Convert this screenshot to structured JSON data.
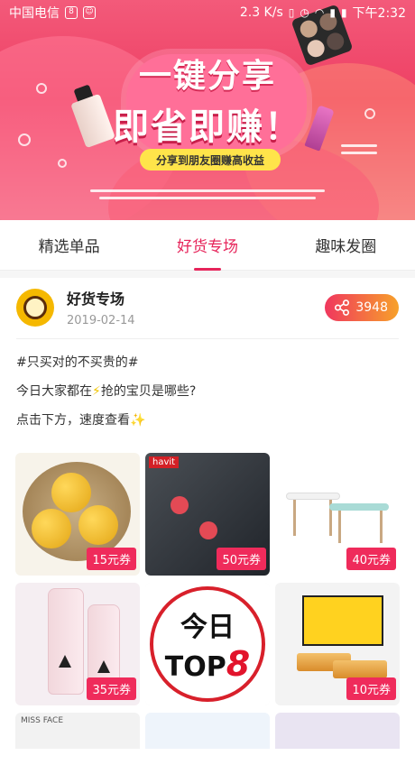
{
  "statusbar": {
    "carrier": "中国电信",
    "speed": "2.3 K/s",
    "time": "下午2:32"
  },
  "banner": {
    "line1": "一键分享",
    "line2": "即省即赚！",
    "subtitle": "分享到朋友圈赚高收益"
  },
  "tabs": [
    {
      "label": "精选单品"
    },
    {
      "label": "好货专场"
    },
    {
      "label": "趣味发圈"
    }
  ],
  "active_tab": "好货专场",
  "post": {
    "author": "好货专场",
    "date": "2019-02-14",
    "share_count": "3948",
    "line1": "#只买对的不买贵的#",
    "line2_a": "今日大家都在",
    "line2_b": "抢的宝贝是哪些?",
    "line3": "点击下方，速度查看"
  },
  "grid": {
    "coupons": [
      "15元券",
      "50元券",
      "40元券",
      "35元券",
      "10元券"
    ],
    "brand_havit": "havit",
    "top8_today": "今日",
    "top8_top": "TOP",
    "top8_num": "8"
  },
  "bottom_row": {
    "item1": "MISS FACE"
  },
  "colors": {
    "accent": "#e6245a",
    "coupon": "#ef2b5b",
    "share_gradient_start": "#f0375e",
    "share_gradient_end": "#f7a12a"
  }
}
